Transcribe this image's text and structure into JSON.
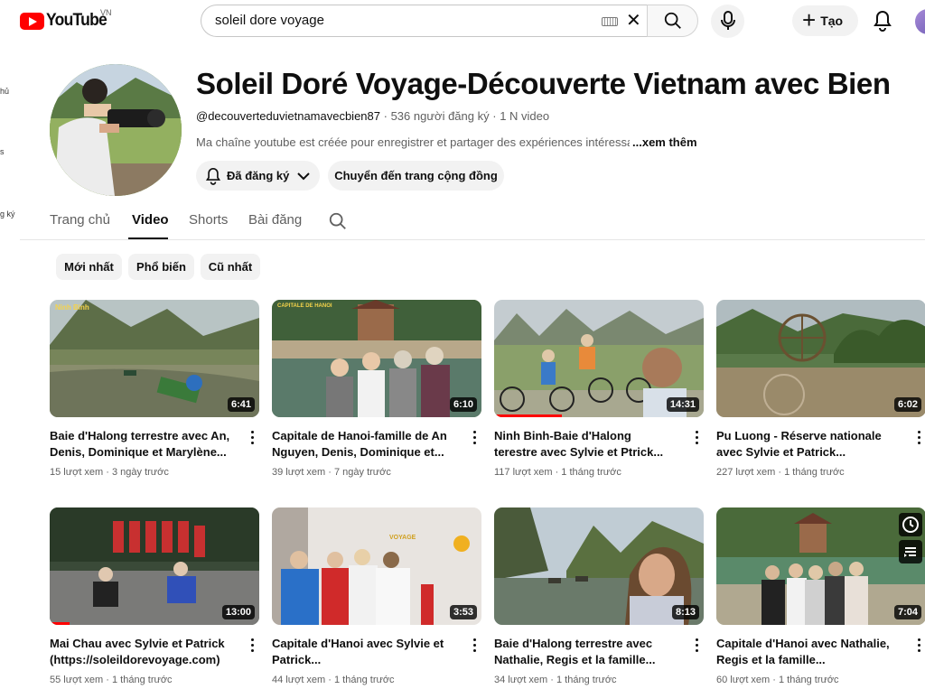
{
  "topbar": {
    "logo_text": "YouTube",
    "country_code": "VN",
    "search_value": "soleil dore voyage",
    "create_label": "Tạo"
  },
  "sidebar_fragments": [
    "hủ",
    "s",
    "g ký"
  ],
  "channel": {
    "title": "Soleil Doré Voyage-Découverte Vietnam avec Bien",
    "handle": "@decouverteduvietnamavecbien87",
    "subscribers": "536 người đăng ký",
    "videos": "1 N video",
    "description": "Ma chaîne youtube est créée pour enregistrer et partager des expériences intéressan",
    "more_label": "...xem thêm",
    "subscribed_label": "Đã đăng ký",
    "community_label": "Chuyển đến trang cộng đồng"
  },
  "tabs": [
    "Trang chủ",
    "Video",
    "Shorts",
    "Bài đăng"
  ],
  "active_tab": "Video",
  "chips": [
    "Mới nhất",
    "Phổ biến",
    "Cũ nhất"
  ],
  "videos": [
    {
      "title": "Baie d'Halong terrestre avec An, Denis, Dominique et Marylène...",
      "views": "15 lượt xem",
      "age": "3 ngày trước",
      "duration": "6:41"
    },
    {
      "title": "Capitale de Hanoi-famille de An Nguyen, Denis, Dominique et...",
      "views": "39 lượt xem",
      "age": "7 ngày trước",
      "duration": "6:10"
    },
    {
      "title": "Ninh Binh-Baie d'Halong terestre avec Sylvie et Ptrick...",
      "views": "117 lượt xem",
      "age": "1 tháng trước",
      "duration": "14:31"
    },
    {
      "title": "Pu Luong - Réserve nationale avec Sylvie et Patrick...",
      "views": "227 lượt xem",
      "age": "1 tháng trước",
      "duration": "6:02"
    },
    {
      "title": "Mai Chau avec Sylvie et Patrick (https://soleildorevoyage.com)",
      "views": "55 lượt xem",
      "age": "1 tháng trước",
      "duration": "13:00"
    },
    {
      "title": "Capitale d'Hanoi avec Sylvie et Patrick...",
      "views": "44 lượt xem",
      "age": "1 tháng trước",
      "duration": "3:53"
    },
    {
      "title": "Baie d'Halong terrestre avec Nathalie, Regis et la famille...",
      "views": "34 lượt xem",
      "age": "1 tháng trước",
      "duration": "8:13"
    },
    {
      "title": "Capitale d'Hanoi avec Nathalie, Regis et la famille...",
      "views": "60 lượt xem",
      "age": "1 tháng trước",
      "duration": "7:04"
    }
  ],
  "thumb_texts": {
    "ninh_binh": "Ninh Bình",
    "capitale": "CAPITALE DE HANOI",
    "sign": "VOYAGE"
  },
  "colors": {
    "accent_red": "#ff0000",
    "chip_bg": "#f2f2f2",
    "text_secondary": "#606060"
  },
  "icons": [
    "keyboard-icon",
    "close-icon",
    "search-icon",
    "mic-icon",
    "plus-icon",
    "bell-icon",
    "chevron-down-icon",
    "kebab-icon",
    "watch-later-icon",
    "add-to-queue-icon"
  ]
}
